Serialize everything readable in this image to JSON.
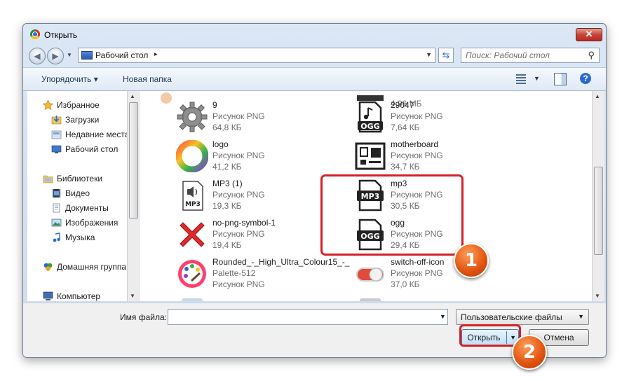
{
  "window": {
    "title": "Открыть",
    "close_label": "✕"
  },
  "navigation": {
    "back_glyph": "◀",
    "forward_glyph": "▶",
    "address": {
      "crumb": "Рабочий стол",
      "arrow": "▸"
    },
    "search_placeholder": "Поиск: Рабочий стол"
  },
  "toolbar": {
    "organize_label": "Упорядочить ▾",
    "new_folder_label": "Новая папка"
  },
  "sidebar": {
    "items": [
      {
        "label": "Избранное",
        "icon": "star-icon"
      },
      {
        "label": "Загрузки",
        "icon": "downloads-icon"
      },
      {
        "label": "Недавние места",
        "icon": "recent-icon"
      },
      {
        "label": "Рабочий стол",
        "icon": "desktop-icon"
      },
      {
        "label": "Библиотеки",
        "icon": "libraries-icon"
      },
      {
        "label": "Видео",
        "icon": "video-icon"
      },
      {
        "label": "Документы",
        "icon": "documents-icon"
      },
      {
        "label": "Изображения",
        "icon": "images-icon"
      },
      {
        "label": "Музыка",
        "icon": "music-icon"
      },
      {
        "label": "Домашняя группа",
        "icon": "homegroup-icon"
      },
      {
        "label": "Компьютер",
        "icon": "computer-icon"
      }
    ]
  },
  "files": {
    "partial_top_right_size": "4,96 МБ",
    "items": [
      {
        "name": "9",
        "type": "Рисунок PNG",
        "size": "64,8 КБ",
        "icon": "gear-icon"
      },
      {
        "name": "29047",
        "type": "Рисунок PNG",
        "size": "7,64 КБ",
        "icon": "ogg-file-icon"
      },
      {
        "name": "logo",
        "type": "Рисунок PNG",
        "size": "41,2 КБ",
        "icon": "logo-icon"
      },
      {
        "name": "motherboard",
        "type": "Рисунок PNG",
        "size": "34,7 КБ",
        "icon": "motherboard-icon"
      },
      {
        "name": "MP3 (1)",
        "type": "Рисунок PNG",
        "size": "19,3 КБ",
        "icon": "mp3-speaker-icon"
      },
      {
        "name": "mp3",
        "type": "Рисунок PNG",
        "size": "30,5 КБ",
        "icon": "mp3-file-icon"
      },
      {
        "name": "no-png-symbol-1",
        "type": "Рисунок PNG",
        "size": "19,4 КБ",
        "icon": "red-x-icon"
      },
      {
        "name": "ogg",
        "type": "Рисунок PNG",
        "size": "29,4 КБ",
        "icon": "ogg-file-icon"
      },
      {
        "name": "Rounded_-_High_Ultra_Colour15_-_",
        "name2": "Palette-512",
        "type": "Рисунок PNG",
        "icon": "palette-icon"
      },
      {
        "name": "switch-off-icon",
        "type": "Рисунок PNG",
        "size": "37,0 КБ",
        "icon": "switch-icon"
      }
    ]
  },
  "footer": {
    "filename_label": "Имя файла:",
    "filename_value": "",
    "filter_label": "Пользовательские файлы",
    "open_label": "Открыть",
    "cancel_label": "Отмена"
  },
  "annotations": {
    "badge1": "1",
    "badge2": "2",
    "accent": "#d61f26"
  }
}
